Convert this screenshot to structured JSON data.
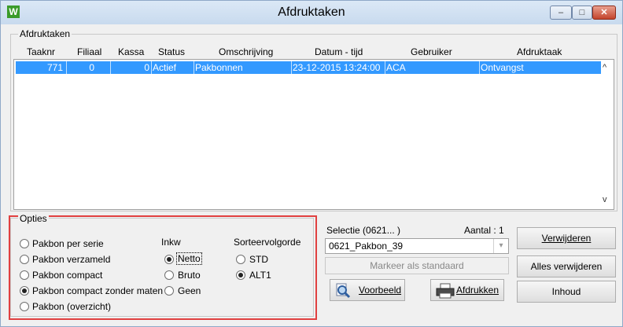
{
  "window": {
    "title": "Afdruktaken",
    "app_icon": "W",
    "controls": {
      "minimize": "–",
      "maximize": "□",
      "close": "✕"
    }
  },
  "group_afdruktaken": {
    "label": "Afdruktaken",
    "columns": [
      "Taaknr",
      "Filiaal",
      "Kassa",
      "Status",
      "Omschrijving",
      "Datum - tijd",
      "Gebruiker",
      "Afdruktaak"
    ],
    "rows": [
      {
        "taaknr": "771",
        "filiaal": "0",
        "kassa": "0",
        "status": "Actief",
        "omschrijving": "Pakbonnen",
        "datum_tijd": "23-12-2015 13:24:00",
        "gebruiker": "ACA",
        "afdruktaak": "Ontvangst"
      }
    ],
    "scroll_up": "^",
    "scroll_down": "v"
  },
  "opties": {
    "label": "Opties",
    "type_options": [
      {
        "label": "Pakbon per serie",
        "selected": false
      },
      {
        "label": "Pakbon verzameld",
        "selected": false
      },
      {
        "label": "Pakbon compact",
        "selected": false
      },
      {
        "label": "Pakbon compact zonder maten",
        "selected": true
      },
      {
        "label": "Pakbon (overzicht)",
        "selected": false
      }
    ],
    "inkw": {
      "label": "Inkw",
      "options": [
        {
          "label": "Netto",
          "selected": true
        },
        {
          "label": "Bruto",
          "selected": false
        },
        {
          "label": "Geen",
          "selected": false
        }
      ]
    },
    "sorteervolgorde": {
      "label": "Sorteervolgorde",
      "options": [
        {
          "label": "STD",
          "selected": false
        },
        {
          "label": "ALT1",
          "selected": true
        }
      ]
    }
  },
  "selectie": {
    "label": "Selectie  (0621... )",
    "aantal_label": "Aantal : 1",
    "combo_value": "0621_Pakbon_39",
    "markeer_label": "Markeer als standaard",
    "voorbeeld_label": "Voorbeeld",
    "afdrukken_label": "Afdrukken"
  },
  "buttons": {
    "verwijderen": "Verwijderen",
    "alles_verwijderen": "Alles verwijderen",
    "inhoud": "Inhoud"
  },
  "colors": {
    "selection": "#3399ff",
    "highlight_border": "#e04040"
  }
}
